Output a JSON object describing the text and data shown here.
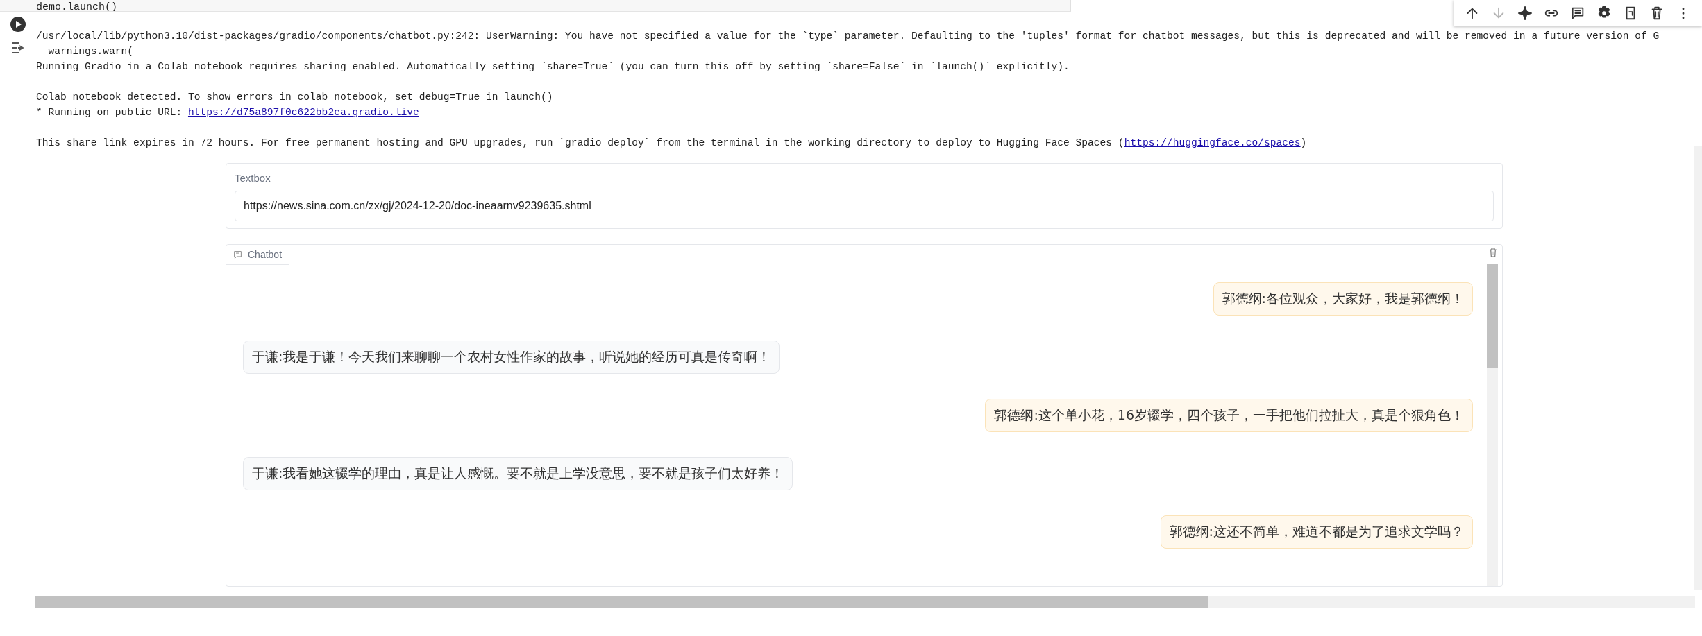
{
  "code_cell": {
    "last_code_line": "demo.launch()"
  },
  "cell_toolbar": [
    {
      "disabled": false
    },
    {
      "disabled": true
    },
    {
      "disabled": false
    },
    {
      "disabled": false
    },
    {
      "disabled": false
    },
    {
      "disabled": false
    },
    {
      "disabled": false
    },
    {
      "disabled": false
    },
    {
      "disabled": false
    }
  ],
  "output_paragraphs": [
    [
      {
        "text": "/usr/local/lib/python3.10/dist-packages/gradio/components/chatbot.py:242: UserWarning: You have not specified a value for the `type` parameter. Defaulting to the 'tuples' format for chatbot messages, but this is deprecated and will be removed in a future version of G"
      },
      {
        "text": "  warnings.warn("
      },
      {
        "text": "Running Gradio in a Colab notebook requires sharing enabled. Automatically setting `share=True` (you can turn this off by setting `share=False` in `launch()` explicitly)."
      }
    ],
    [
      {
        "text": "Colab notebook detected. To show errors in colab notebook, set debug=True in launch()"
      },
      {
        "text": "* Running on public URL: ",
        "link": "https://d75a897f0c622bb2ea.gradio.live"
      }
    ],
    [
      {
        "text": "This share link expires in 72 hours. For free permanent hosting and GPU upgrades, run `gradio deploy` from the terminal in the working directory to deploy to Hugging Face Spaces (",
        "link": "https://huggingface.co/spaces",
        "after": ")"
      }
    ]
  ],
  "textbox": {
    "label": "Textbox",
    "value": "https://news.sina.com.cn/zx/gj/2024-12-20/doc-ineaarnv9239635.shtml"
  },
  "chatbot": {
    "label": "Chatbot",
    "messages": [
      {
        "from_user": true,
        "text": "郭德纲:各位观众，大家好，我是郭德纲！"
      },
      {
        "from_user": false,
        "text": "于谦:我是于谦！今天我们来聊聊一个农村女性作家的故事，听说她的经历可真是传奇啊！"
      },
      {
        "from_user": true,
        "text": "郭德纲:这个单小花，16岁辍学，四个孩子，一手把他们拉扯大，真是个狠角色！"
      },
      {
        "from_user": false,
        "text": "于谦:我看她这辍学的理由，真是让人感慨。要不就是上学没意思，要不就是孩子们太好养！"
      },
      {
        "from_user": true,
        "text": "郭德纲:这还不简单，难道不都是为了追求文学吗？"
      }
    ]
  }
}
